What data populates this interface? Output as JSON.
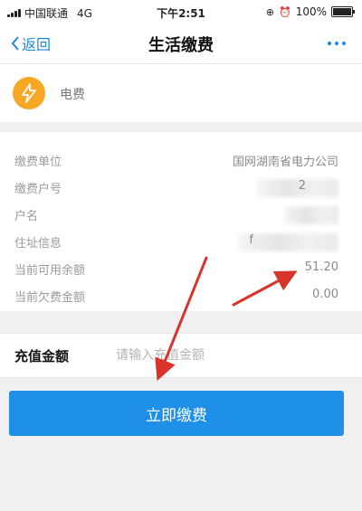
{
  "status_bar": {
    "carrier": "中国联通",
    "network": "4G",
    "time": "下午2:51",
    "battery": "100%",
    "battery_level": 1.0
  },
  "nav": {
    "back_label": "返回",
    "title": "生活缴费",
    "more_icon": "more-dots-icon",
    "accent_color": "#1e88e5"
  },
  "biz": {
    "icon": "lightning-icon",
    "icon_color": "#f7a823",
    "name": "电费"
  },
  "info": {
    "rows": [
      {
        "label": "缴费单位",
        "value": "国网湖南省电力公司"
      },
      {
        "label": "缴费户号",
        "value": "2"
      },
      {
        "label": "户名",
        "value": ""
      },
      {
        "label": "住址信息",
        "value": "f"
      },
      {
        "label": "当前可用余额",
        "value": "51.20"
      },
      {
        "label": "当前欠费金额",
        "value": "0.00"
      }
    ]
  },
  "amount": {
    "label": "充值金额",
    "placeholder": "请输入充值金额"
  },
  "pay_button": {
    "label": "立即缴费",
    "color": "#1e90e8"
  },
  "annotation_color": "#d9342b"
}
